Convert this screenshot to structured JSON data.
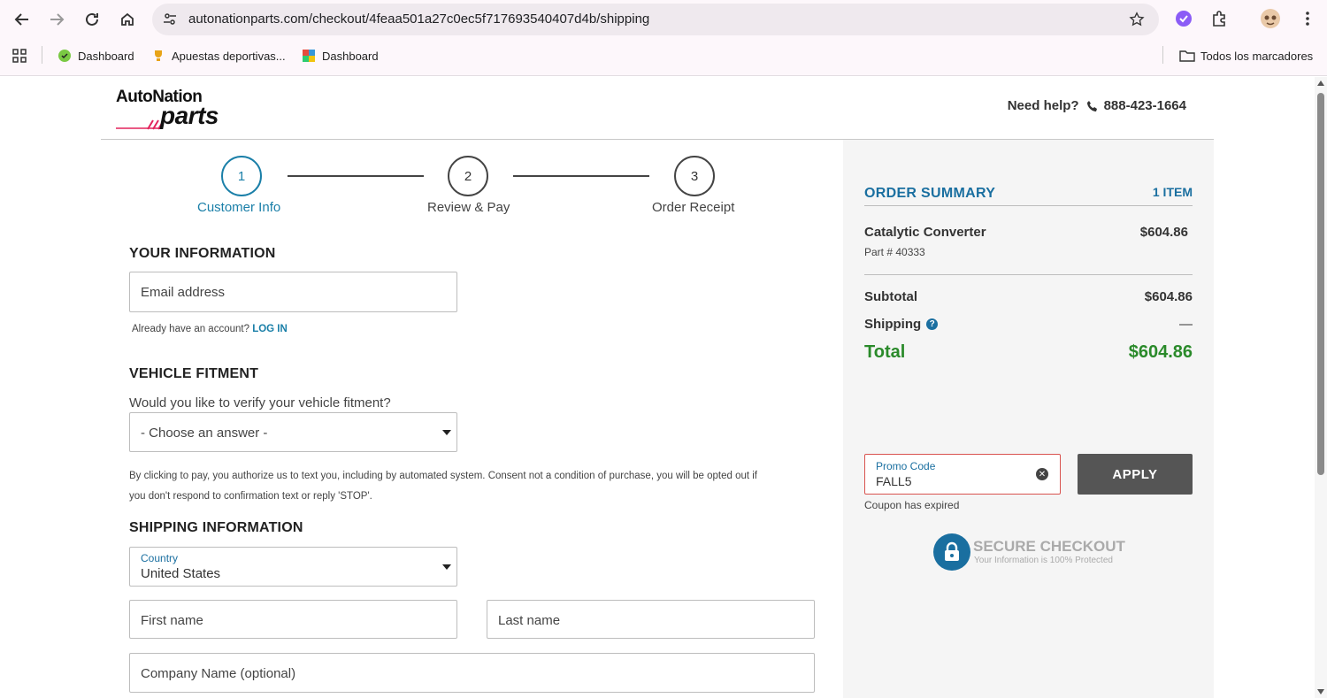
{
  "browser": {
    "url": "autonationparts.com/checkout/4feaa501a27c0ec5f717693540407d4b/shipping",
    "bookmarks": [
      "Dashboard",
      "Apuestas deportivas...",
      "Dashboard"
    ],
    "all_bookmarks": "Todos los marcadores"
  },
  "header": {
    "logo_top": "AutoNation",
    "logo_bottom": "parts",
    "help_label": "Need help?",
    "phone": "888-423-1664"
  },
  "steps": [
    {
      "number": "1",
      "label": "Customer Info"
    },
    {
      "number": "2",
      "label": "Review & Pay"
    },
    {
      "number": "3",
      "label": "Order Receipt"
    }
  ],
  "your_info": {
    "title": "YOUR INFORMATION",
    "email_placeholder": "Email address",
    "account_text": "Already have an account?",
    "login_link": "LOG IN"
  },
  "vehicle": {
    "title": "VEHICLE FITMENT",
    "question": "Would you like to verify your vehicle fitment?",
    "select_value": "- Choose an answer -",
    "consent_line1": "By clicking to pay, you authorize us to text you, including by automated system. Consent not a condition of purchase, you will be opted out if",
    "consent_line2": "you don't respond to confirmation text or reply 'STOP'."
  },
  "shipping": {
    "title": "SHIPPING INFORMATION",
    "country_label": "Country",
    "country_value": "United States",
    "first_name_placeholder": "First name",
    "last_name_placeholder": "Last name",
    "company_placeholder": "Company Name (optional)"
  },
  "summary": {
    "title": "ORDER SUMMARY",
    "item_count": "1 ITEM",
    "item_name": "Catalytic Converter",
    "item_price": "$604.86",
    "part_number": "Part # 40333",
    "subtotal_label": "Subtotal",
    "subtotal_value": "$604.86",
    "shipping_label": "Shipping",
    "shipping_value": "—",
    "total_label": "Total",
    "total_value": "$604.86",
    "promo_label": "Promo Code",
    "promo_value": "FALL5",
    "apply_label": "APPLY",
    "coupon_message": "Coupon has expired",
    "secure_title": "SECURE CHECKOUT",
    "secure_subtitle": "Your Information is 100% Protected"
  },
  "colors": {
    "accent": "#1a7fa8",
    "total_green": "#2a8a2a",
    "error_border": "#d9534f",
    "apply_button": "#555555"
  }
}
